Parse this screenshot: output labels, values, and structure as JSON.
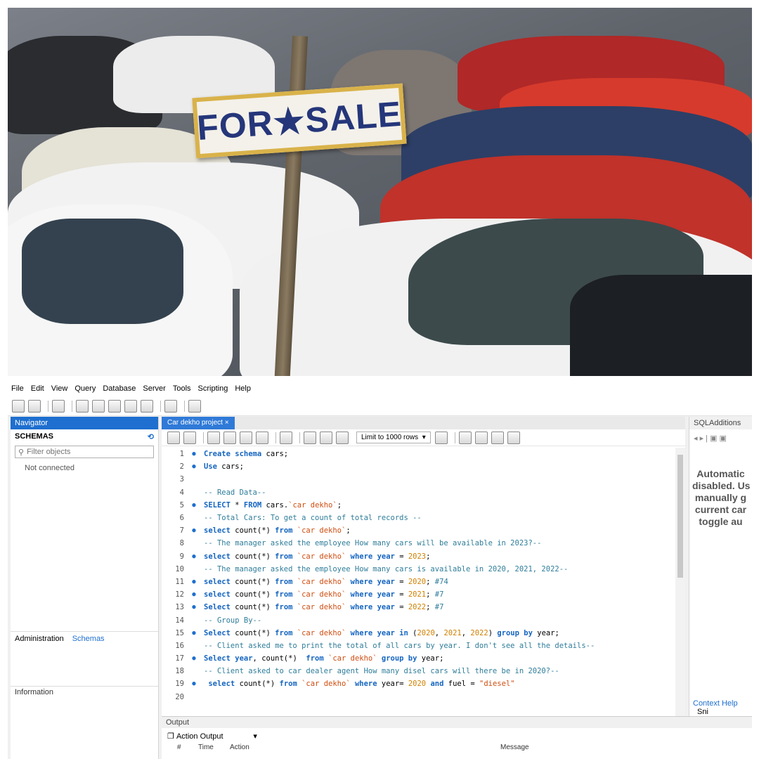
{
  "photo": {
    "sign_text": "FOR★SALE"
  },
  "menu": [
    "File",
    "Edit",
    "View",
    "Query",
    "Database",
    "Server",
    "Tools",
    "Scripting",
    "Help"
  ],
  "navigator": {
    "title": "Navigator",
    "schemas_label": "SCHEMAS",
    "filter_placeholder": "Filter objects",
    "status": "Not connected",
    "tab_admin": "Administration",
    "tab_schemas": "Schemas",
    "info_label": "Information"
  },
  "editor": {
    "tab_label": "Car dekho project",
    "limit_label": "Limit to 1000 rows",
    "lines": [
      {
        "n": "1",
        "dot": true,
        "parts": [
          [
            "kw",
            "Create schema "
          ],
          [
            "tx",
            "cars;"
          ]
        ]
      },
      {
        "n": "2",
        "dot": true,
        "parts": [
          [
            "kw",
            "Use "
          ],
          [
            "tx",
            "cars;"
          ]
        ]
      },
      {
        "n": "3",
        "dot": false,
        "parts": []
      },
      {
        "n": "4",
        "dot": false,
        "parts": [
          [
            "cm",
            "-- Read Data--"
          ]
        ]
      },
      {
        "n": "5",
        "dot": true,
        "parts": [
          [
            "kw",
            "SELECT "
          ],
          [
            "tx",
            "* "
          ],
          [
            "kw",
            "FROM "
          ],
          [
            "tx",
            "cars."
          ],
          [
            "st",
            "`car dekho`"
          ],
          [
            "tx",
            ";"
          ]
        ]
      },
      {
        "n": "6",
        "dot": false,
        "parts": [
          [
            "cm",
            "-- Total Cars: To get a count of total records --"
          ]
        ]
      },
      {
        "n": "7",
        "dot": true,
        "parts": [
          [
            "kw",
            "select "
          ],
          [
            "tx",
            "count(*) "
          ],
          [
            "kw",
            "from "
          ],
          [
            "st",
            "`car dekho`"
          ],
          [
            "tx",
            ";"
          ]
        ]
      },
      {
        "n": "8",
        "dot": false,
        "parts": [
          [
            "cm",
            "-- The manager asked the employee How many cars will be available in 2023?--"
          ]
        ]
      },
      {
        "n": "9",
        "dot": true,
        "parts": [
          [
            "kw",
            "select "
          ],
          [
            "tx",
            "count(*) "
          ],
          [
            "kw",
            "from "
          ],
          [
            "st",
            "`car dekho` "
          ],
          [
            "kw",
            "where year "
          ],
          [
            "tx",
            "= "
          ],
          [
            "nm",
            "2023"
          ],
          [
            "tx",
            ";"
          ]
        ]
      },
      {
        "n": "10",
        "dot": false,
        "parts": [
          [
            "cm",
            "-- The manager asked the employee How many cars is available in 2020, 2021, 2022--"
          ]
        ]
      },
      {
        "n": "11",
        "dot": true,
        "parts": [
          [
            "kw",
            "select "
          ],
          [
            "tx",
            "count(*) "
          ],
          [
            "kw",
            "from "
          ],
          [
            "st",
            "`car dekho` "
          ],
          [
            "kw",
            "where year "
          ],
          [
            "tx",
            "= "
          ],
          [
            "nm",
            "2020"
          ],
          [
            "tx",
            "; "
          ],
          [
            "cm",
            "#74"
          ]
        ]
      },
      {
        "n": "12",
        "dot": true,
        "parts": [
          [
            "kw",
            "select "
          ],
          [
            "tx",
            "count(*) "
          ],
          [
            "kw",
            "from "
          ],
          [
            "st",
            "`car dekho` "
          ],
          [
            "kw",
            "where year "
          ],
          [
            "tx",
            "= "
          ],
          [
            "nm",
            "2021"
          ],
          [
            "tx",
            "; "
          ],
          [
            "cm",
            "#7"
          ]
        ]
      },
      {
        "n": "13",
        "dot": true,
        "parts": [
          [
            "kw",
            "Select "
          ],
          [
            "tx",
            "count(*) "
          ],
          [
            "kw",
            "from "
          ],
          [
            "st",
            "`car dekho` "
          ],
          [
            "kw",
            "where year "
          ],
          [
            "tx",
            "= "
          ],
          [
            "nm",
            "2022"
          ],
          [
            "tx",
            "; "
          ],
          [
            "cm",
            "#7"
          ]
        ]
      },
      {
        "n": "14",
        "dot": false,
        "parts": [
          [
            "cm",
            "-- Group By--"
          ]
        ]
      },
      {
        "n": "15",
        "dot": true,
        "parts": [
          [
            "kw",
            "Select "
          ],
          [
            "tx",
            "count(*) "
          ],
          [
            "kw",
            "from "
          ],
          [
            "st",
            "`car dekho` "
          ],
          [
            "kw",
            "where year in "
          ],
          [
            "tx",
            "("
          ],
          [
            "nm",
            "2020"
          ],
          [
            "tx",
            ", "
          ],
          [
            "nm",
            "2021"
          ],
          [
            "tx",
            ", "
          ],
          [
            "nm",
            "2022"
          ],
          [
            "tx",
            ") "
          ],
          [
            "kw",
            "group by "
          ],
          [
            "tx",
            "year;"
          ]
        ]
      },
      {
        "n": "16",
        "dot": false,
        "parts": [
          [
            "cm",
            "-- Client asked me to print the total of all cars by year. I don't see all the details--"
          ]
        ]
      },
      {
        "n": "17",
        "dot": true,
        "parts": [
          [
            "kw",
            "Select year"
          ],
          [
            "tx",
            ", count(*)  "
          ],
          [
            "kw",
            "from "
          ],
          [
            "st",
            "`car dekho` "
          ],
          [
            "kw",
            "group by "
          ],
          [
            "tx",
            "year;"
          ]
        ]
      },
      {
        "n": "18",
        "dot": false,
        "parts": [
          [
            "cm",
            "-- Client asked to car dealer agent How many disel cars will there be in 2020?--"
          ]
        ]
      },
      {
        "n": "19",
        "dot": true,
        "parts": [
          [
            "tx",
            " "
          ],
          [
            "kw",
            "select "
          ],
          [
            "tx",
            "count(*) "
          ],
          [
            "kw",
            "from "
          ],
          [
            "st",
            "`car dekho` "
          ],
          [
            "kw",
            "where "
          ],
          [
            "tx",
            "year= "
          ],
          [
            "nm",
            "2020 "
          ],
          [
            "kw",
            "and "
          ],
          [
            "tx",
            "fuel = "
          ],
          [
            "st",
            "\"diesel\""
          ]
        ]
      },
      {
        "n": "20",
        "dot": false,
        "parts": []
      }
    ]
  },
  "sql_additions": {
    "title": "SQLAdditions",
    "text_lines": [
      "Automatic",
      "disabled. Us",
      "manually g",
      "current car",
      "toggle au"
    ],
    "tab_context": "Context Help",
    "tab_snippets": "Sni"
  },
  "output": {
    "title": "Output",
    "dropdown": "Action Output",
    "columns": [
      "#",
      "Time",
      "Action",
      "Message"
    ]
  }
}
